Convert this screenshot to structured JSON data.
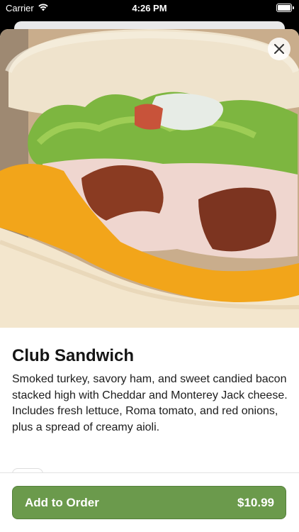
{
  "status_bar": {
    "carrier": "Carrier",
    "time": "4:26 PM"
  },
  "item": {
    "name": "Club Sandwich",
    "description": "Smoked turkey, savory ham, and sweet candied bacon stacked high with Cheddar and Monterey Jack cheese. Includes fresh lettuce,  Roma tomato, and red onions, plus a spread of creamy aioli.",
    "image_alt": "Club sandwich photo"
  },
  "actions": {
    "add_label": "Add to Order",
    "price": "$10.99"
  },
  "colors": {
    "button": "#6b9a4c",
    "text": "#1c1c1c"
  }
}
